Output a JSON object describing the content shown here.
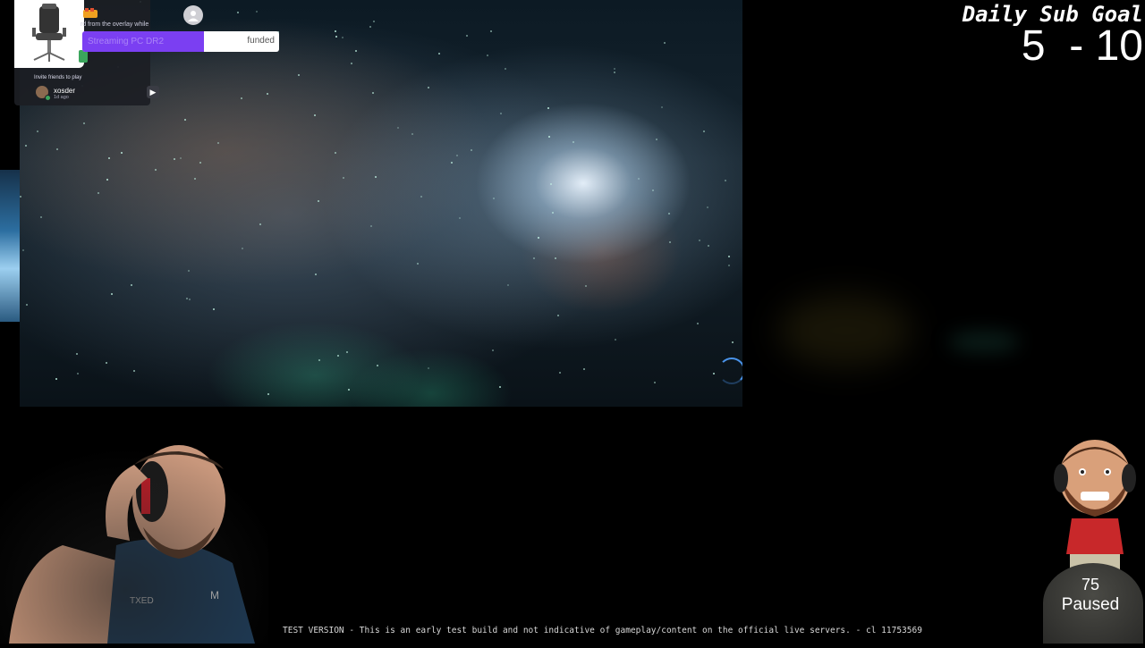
{
  "overlay": {
    "notice_text": "rd from the overlay while",
    "invite_label": "Invite friends to play",
    "friend": {
      "name": "xosder",
      "time": "1d ago"
    }
  },
  "funded_bar": {
    "name": "Streaming PC DR2",
    "percent_text": "62%",
    "label": "funded",
    "progress": 0.62,
    "color": "#7b3ff2"
  },
  "sub_goal": {
    "title": "Daily Sub Goal",
    "count": "5  - 10"
  },
  "counter": {
    "value": "75",
    "status": "Paused"
  },
  "test_banner": "TEST VERSION - This is an early test build and not indicative of gameplay/content on the official live servers. - cl 11753569",
  "icons": {
    "chair": "office-chair-icon",
    "sub": "sub-badge-icon",
    "avatar": "user-avatar-icon",
    "loading": "loading-ring-icon",
    "play": "play-arrow-icon"
  }
}
